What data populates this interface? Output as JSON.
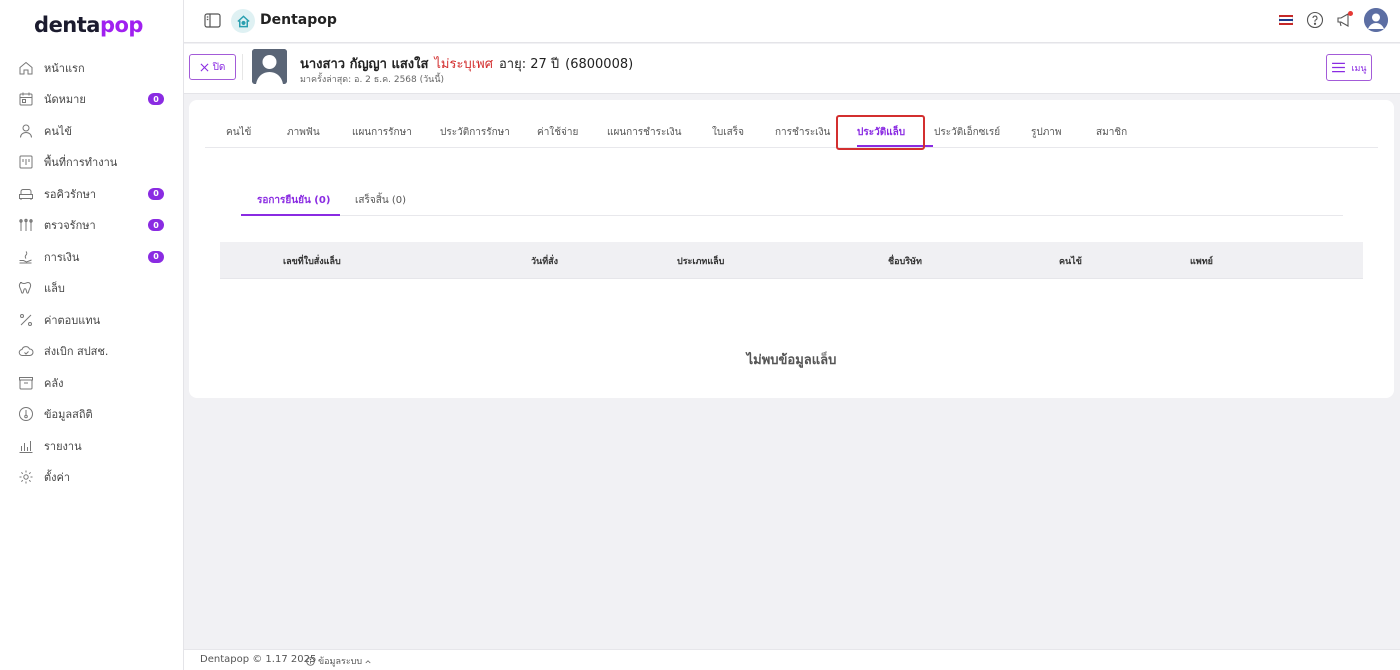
{
  "app": {
    "logo_main": "denta",
    "logo_accent": "pop",
    "title": "Dentapop"
  },
  "colors": {
    "accent": "#8a2be2",
    "warning": "#d32f2f",
    "badge": "#8a2be2"
  },
  "sidebar": {
    "items": [
      {
        "label": "หน้าแรก",
        "icon": "home-icon"
      },
      {
        "label": "นัดหมาย",
        "icon": "calendar-icon",
        "badge": "0"
      },
      {
        "label": "คนไข้",
        "icon": "user-icon"
      },
      {
        "label": "พื้นที่การทำงาน",
        "icon": "workspace-icon"
      },
      {
        "label": "รอคิวรักษา",
        "icon": "sofa-icon",
        "badge": "0"
      },
      {
        "label": "ตรวจรักษา",
        "icon": "dental-tools-icon",
        "badge": "0"
      },
      {
        "label": "การเงิน",
        "icon": "money-hand-icon",
        "badge": "0"
      },
      {
        "label": "แล็บ",
        "icon": "tooth-icon"
      },
      {
        "label": "ค่าตอบแทน",
        "icon": "percent-icon"
      },
      {
        "label": "ส่งเบิก สปสช.",
        "icon": "cloud-icon"
      },
      {
        "label": "คลัง",
        "icon": "box-icon"
      },
      {
        "label": "ข้อมูลสถิติ",
        "icon": "thermometer-icon"
      },
      {
        "label": "รายงาน",
        "icon": "bar-chart-icon"
      },
      {
        "label": "ตั้งค่า",
        "icon": "gear-icon"
      }
    ]
  },
  "patient": {
    "close_label": "ปิด",
    "name": "นางสาว กัญญา แสงใส",
    "gender": "ไม่ระบุเพศ",
    "age": "อายุ: 27 ปี",
    "hn": "(6800008)",
    "last_visit": "มาครั้งล่าสุด: อ. 2 ธ.ค. 2568 (วันนี้)",
    "menu_label": "เมนู"
  },
  "tabs": [
    {
      "label": "คนไข้"
    },
    {
      "label": "ภาพฟัน"
    },
    {
      "label": "แผนการรักษา"
    },
    {
      "label": "ประวัติการรักษา"
    },
    {
      "label": "ค่าใช้จ่าย"
    },
    {
      "label": "แผนการชำระเงิน"
    },
    {
      "label": "ใบเสร็จ"
    },
    {
      "label": "การชำระเงิน"
    },
    {
      "label": "ประวัติแล็บ",
      "active": true
    },
    {
      "label": "ประวัติเอ็กซเรย์"
    },
    {
      "label": "รูปภาพ"
    },
    {
      "label": "สมาชิก"
    }
  ],
  "subtabs": [
    {
      "label": "รอการยืนยัน (0)",
      "active": true
    },
    {
      "label": "เสร็จสิ้น (0)"
    }
  ],
  "table": {
    "columns": [
      "เลขที่ใบสั่งแล็บ",
      "วันที่สั่ง",
      "ประเภทแล็บ",
      "ชื่อบริษัท",
      "คนไข้",
      "แพทย์"
    ],
    "empty_message": "ไม่พบข้อมูลแล็บ"
  },
  "footer": {
    "copyright": "Dentapop © 1.17 2025",
    "system_info": "ข้อมูลระบบ"
  }
}
